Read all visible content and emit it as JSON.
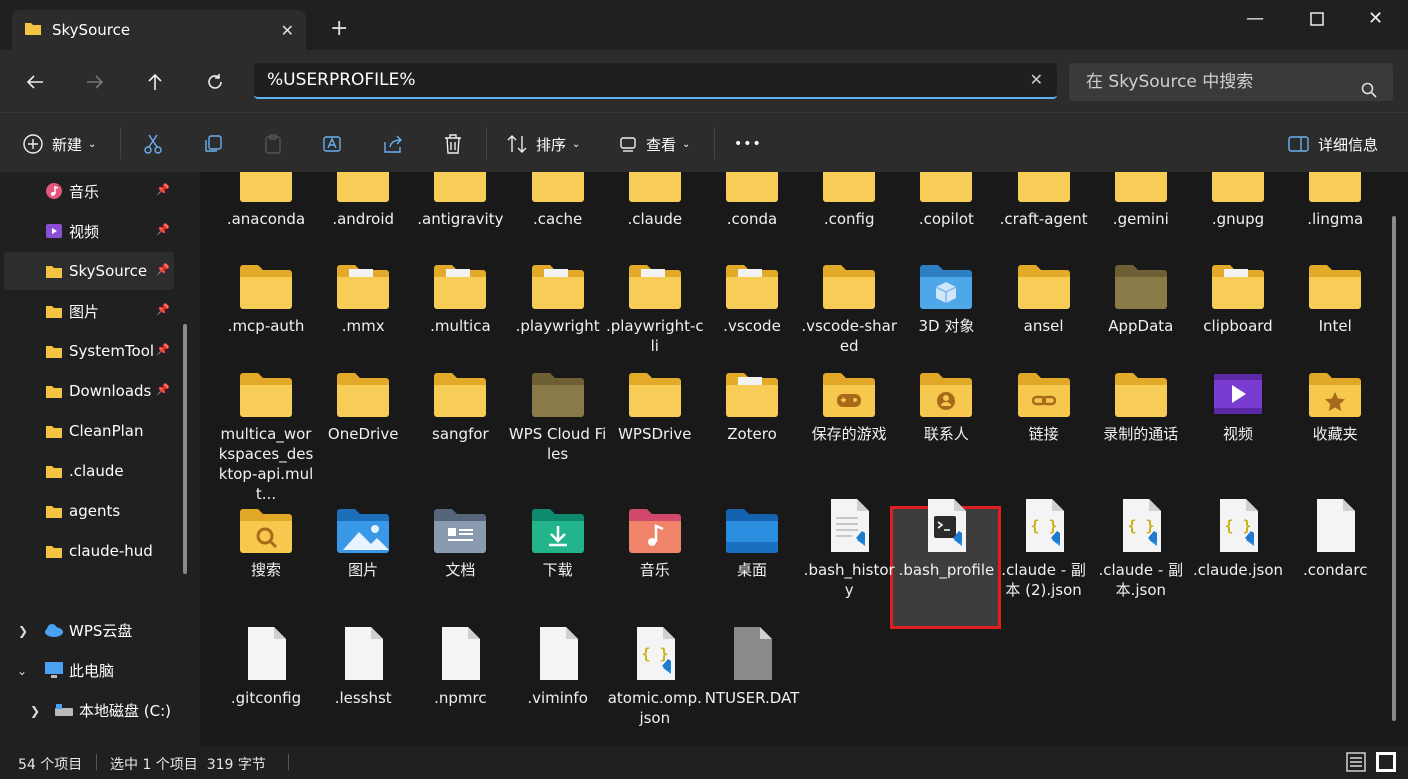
{
  "window": {
    "tab_title": "SkySource",
    "new_tab": "+"
  },
  "address": {
    "value": "%USERPROFILE%"
  },
  "search": {
    "placeholder": "在 SkySource 中搜索"
  },
  "toolbar": {
    "new_label": "新建",
    "sort_label": "排序",
    "view_label": "查看",
    "more_label": "•••",
    "details_label": "详细信息"
  },
  "sidebar": {
    "items": [
      {
        "label": "音乐",
        "icon": "music-icon",
        "pinned": true
      },
      {
        "label": "视频",
        "icon": "video-icon",
        "pinned": true
      },
      {
        "label": "SkySource",
        "icon": "folder-icon",
        "pinned": true,
        "selected": true
      },
      {
        "label": "图片",
        "icon": "folder-icon",
        "pinned": true
      },
      {
        "label": "SystemTool",
        "icon": "folder-icon",
        "pinned": true
      },
      {
        "label": "Downloads",
        "icon": "folder-icon",
        "pinned": true
      },
      {
        "label": "CleanPlan",
        "icon": "folder-icon",
        "pinned": false
      },
      {
        "label": ".claude",
        "icon": "folder-icon",
        "pinned": false
      },
      {
        "label": "agents",
        "icon": "folder-icon",
        "pinned": false
      },
      {
        "label": "claude-hud",
        "icon": "folder-icon",
        "pinned": false
      }
    ],
    "wps": "WPS云盘",
    "pc": "此电脑",
    "drive_c": "本地磁盘 (C:)"
  },
  "files": [
    {
      "name": ".anaconda",
      "icon": "folder-doc"
    },
    {
      "name": ".android",
      "icon": "folder-doc"
    },
    {
      "name": ".antigravity",
      "icon": "folder-doc"
    },
    {
      "name": ".cache",
      "icon": "folder"
    },
    {
      "name": ".claude",
      "icon": "folder-doc"
    },
    {
      "name": ".conda",
      "icon": "folder-doc"
    },
    {
      "name": ".config",
      "icon": "folder"
    },
    {
      "name": ".copilot",
      "icon": "folder"
    },
    {
      "name": ".craft-agent",
      "icon": "folder-doc"
    },
    {
      "name": ".gemini",
      "icon": "folder"
    },
    {
      "name": ".gnupg",
      "icon": "folder-doc"
    },
    {
      "name": ".lingma",
      "icon": "folder"
    },
    {
      "name": ".mcp-auth",
      "icon": "folder"
    },
    {
      "name": ".mmx",
      "icon": "folder-doc"
    },
    {
      "name": ".multica",
      "icon": "folder-doc"
    },
    {
      "name": ".playwright",
      "icon": "folder-doc"
    },
    {
      "name": ".playwright-cli",
      "icon": "folder-doc"
    },
    {
      "name": ".vscode",
      "icon": "folder-doc"
    },
    {
      "name": ".vscode-shared",
      "icon": "folder"
    },
    {
      "name": "3D 对象",
      "icon": "3d"
    },
    {
      "name": "ansel",
      "icon": "folder"
    },
    {
      "name": "AppData",
      "icon": "folder-dim"
    },
    {
      "name": "clipboard",
      "icon": "folder-doc"
    },
    {
      "name": "Intel",
      "icon": "folder"
    },
    {
      "name": "multica_workspaces_desktop-api.mult...",
      "icon": "folder"
    },
    {
      "name": "OneDrive",
      "icon": "folder"
    },
    {
      "name": "sangfor",
      "icon": "folder"
    },
    {
      "name": "WPS Cloud Files",
      "icon": "folder-dim"
    },
    {
      "name": "WPSDrive",
      "icon": "folder"
    },
    {
      "name": "Zotero",
      "icon": "folder-doc"
    },
    {
      "name": "保存的游戏",
      "icon": "folder-game"
    },
    {
      "name": "联系人",
      "icon": "folder-contact"
    },
    {
      "name": "链接",
      "icon": "folder-link"
    },
    {
      "name": "录制的通话",
      "icon": "folder"
    },
    {
      "name": "视频",
      "icon": "video"
    },
    {
      "name": "收藏夹",
      "icon": "folder-star"
    },
    {
      "name": "搜索",
      "icon": "folder-search"
    },
    {
      "name": "图片",
      "icon": "pictures"
    },
    {
      "name": "文档",
      "icon": "documents"
    },
    {
      "name": "下载",
      "icon": "downloads"
    },
    {
      "name": "音乐",
      "icon": "music"
    },
    {
      "name": "桌面",
      "icon": "desktop"
    },
    {
      "name": ".bash_history",
      "icon": "file-vs"
    },
    {
      "name": ".bash_profile",
      "icon": "file-term",
      "selected": true
    },
    {
      "name": ".claude - 副本 (2).json",
      "icon": "json"
    },
    {
      "name": ".claude - 副本.json",
      "icon": "json"
    },
    {
      "name": ".claude.json",
      "icon": "json"
    },
    {
      "name": ".condarc",
      "icon": "file"
    },
    {
      "name": ".gitconfig",
      "icon": "file"
    },
    {
      "name": ".lesshst",
      "icon": "file"
    },
    {
      "name": ".npmrc",
      "icon": "file"
    },
    {
      "name": ".viminfo",
      "icon": "file"
    },
    {
      "name": "atomic.omp.json",
      "icon": "json"
    },
    {
      "name": "NTUSER.DAT",
      "icon": "file-gray"
    }
  ],
  "status": {
    "count": "54 个项目",
    "selection": "选中 1 个项目  319 字节"
  }
}
